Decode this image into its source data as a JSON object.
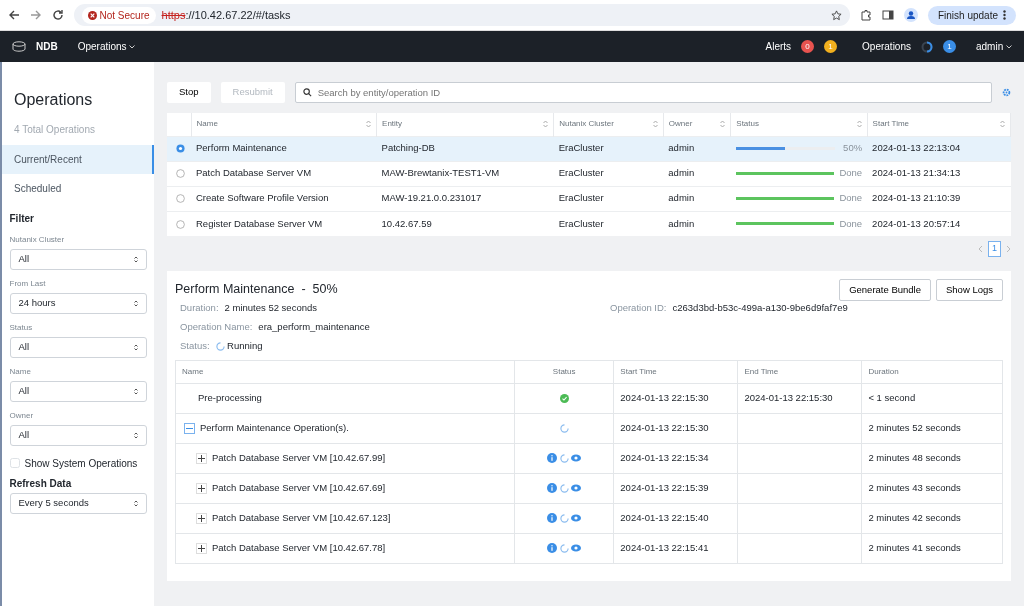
{
  "browser": {
    "security": "Not Secure",
    "url_scheme": "https",
    "url_rest": "://10.42.67.22/#/tasks",
    "update_button": "Finish update"
  },
  "navbar": {
    "brand": "NDB",
    "menu": "Operations",
    "alerts_label": "Alerts",
    "alert_counts": [
      {
        "count": "0",
        "color": "#e8534f"
      },
      {
        "count": "1",
        "color": "#f2b01e"
      }
    ],
    "operations_label": "Operations",
    "operations_count": "1",
    "user": "admin"
  },
  "sidebar": {
    "title": "Operations",
    "total": "4 Total Operations",
    "nav": [
      {
        "label": "Current/Recent",
        "selected": true
      },
      {
        "label": "Scheduled",
        "selected": false
      }
    ],
    "filter_title": "Filter",
    "filters": [
      {
        "label": "Nutanix Cluster",
        "value": "All"
      },
      {
        "label": "From Last",
        "value": "24 hours"
      },
      {
        "label": "Status",
        "value": "All"
      },
      {
        "label": "Name",
        "value": "All"
      },
      {
        "label": "Owner",
        "value": "All"
      }
    ],
    "show_system": {
      "label": "Show System Operations",
      "checked": false
    },
    "refresh": {
      "label": "Refresh Data",
      "value": "Every 5 seconds"
    }
  },
  "toolbar": {
    "buttons": [
      {
        "label": "Stop",
        "disabled": false
      },
      {
        "label": "Resubmit",
        "disabled": true
      }
    ],
    "search": {
      "placeholder": "Search by entity/operation ID"
    }
  },
  "operations": {
    "columns": [
      "Name",
      "Entity",
      "Nutanix Cluster",
      "Owner",
      "Status",
      "Start Time"
    ],
    "rows": [
      {
        "selected": true,
        "name": "Perform Maintenance",
        "entity": "Patching-DB",
        "cluster": "EraCluster",
        "owner": "admin",
        "kind": "running",
        "level": 0.5,
        "status": "50%",
        "start": "2024-01-13 22:13:04"
      },
      {
        "selected": false,
        "name": "Patch Database Server VM",
        "entity": "MAW-Brewtanix-TEST1-VM",
        "cluster": "EraCluster",
        "owner": "admin",
        "kind": "done",
        "level": 1,
        "status": "Done",
        "start": "2024-01-13 21:34:13"
      },
      {
        "selected": false,
        "name": "Create Software Profile Version",
        "entity": "MAW-19.21.0.0.231017",
        "cluster": "EraCluster",
        "owner": "admin",
        "kind": "done",
        "level": 1,
        "status": "Done",
        "start": "2024-01-13 21:10:39"
      },
      {
        "selected": false,
        "name": "Register Database Server VM",
        "entity": "10.42.67.59",
        "cluster": "EraCluster",
        "owner": "admin",
        "kind": "done",
        "level": 1,
        "status": "Done",
        "start": "2024-01-13 20:57:14"
      }
    ],
    "pagination": {
      "page": "1"
    }
  },
  "detail": {
    "title": "Perform Maintenance  -  50%",
    "buttons": [
      "Generate Bundle",
      "Show Logs"
    ],
    "duration": {
      "label": "Duration:",
      "value": "2 minutes 52 seconds"
    },
    "operation_id": {
      "label": "Operation ID:",
      "value": "c263d3bd-b53c-499a-a130-9be6d9faf7e9"
    },
    "operation_name": {
      "label": "Operation Name:",
      "value": "era_perform_maintenance"
    },
    "status": {
      "label": "Status:",
      "value": "Running"
    },
    "steps": {
      "columns": [
        "Name",
        "Status",
        "Start Time",
        "End Time",
        "Duration"
      ],
      "rows": [
        {
          "name": "Pre-processing",
          "kind": "success",
          "start": "2024-01-13 22:15:30",
          "end": "2024-01-13 22:15:30",
          "duration": "< 1 second"
        },
        {
          "name": "Perform Maintenance Operation(s).",
          "expanded": true,
          "kind": "running",
          "start": "2024-01-13 22:15:30",
          "duration": "2 minutes 52 seconds",
          "children": [
            {
              "name": "Patch Database Server VM [10.42.67.99]",
              "expanded": false,
              "kind": "running_actions",
              "start": "2024-01-13 22:15:34",
              "duration": "2 minutes 48 seconds"
            },
            {
              "name": "Patch Database Server VM [10.42.67.69]",
              "expanded": false,
              "kind": "running_actions",
              "start": "2024-01-13 22:15:39",
              "duration": "2 minutes 43 seconds"
            },
            {
              "name": "Patch Database Server VM [10.42.67.123]",
              "expanded": false,
              "kind": "running_actions",
              "start": "2024-01-13 22:15:40",
              "duration": "2 minutes 42 seconds"
            },
            {
              "name": "Patch Database Server VM [10.42.67.78]",
              "expanded": false,
              "kind": "running_actions",
              "start": "2024-01-13 22:15:41",
              "duration": "2 minutes 41 seconds"
            }
          ]
        }
      ]
    }
  }
}
